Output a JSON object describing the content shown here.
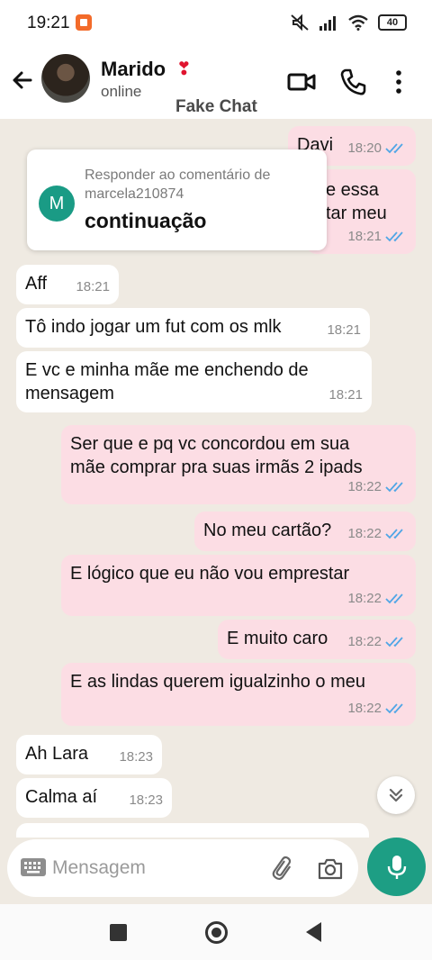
{
  "status_bar": {
    "time": "19:21",
    "battery": "40"
  },
  "header": {
    "contact_name": "Marido",
    "heart": "❣",
    "contact_status": "online",
    "watermark": "Fake Chat"
  },
  "reply_card": {
    "avatar_letter": "M",
    "title": "Responder ao comentário de marcela210874",
    "text": "continuação"
  },
  "messages": [
    {
      "dir": "out",
      "text": "Davi",
      "time": "18:20"
    },
    {
      "dir": "out",
      "text": "e essa\ntar meu",
      "time": "18:21"
    },
    {
      "dir": "in",
      "text": "Aff",
      "time": "18:21"
    },
    {
      "dir": "in",
      "text": "Tô indo jogar um fut com os mlk",
      "time": "18:21"
    },
    {
      "dir": "in",
      "text": "E vc e minha mãe me enchendo de\nmensagem",
      "time": "18:21"
    },
    {
      "dir": "out",
      "text": "Ser que e pq vc concordou em sua\nmãe comprar pra suas irmãs 2 ipads",
      "time": "18:22"
    },
    {
      "dir": "out",
      "text": "No meu cartão?",
      "time": "18:22"
    },
    {
      "dir": "out",
      "text": "E lógico que eu não vou emprestar",
      "time": "18:22"
    },
    {
      "dir": "out",
      "text": "E muito caro",
      "time": "18:22"
    },
    {
      "dir": "out",
      "text": "E as lindas querem igualzinho o meu",
      "time": "18:22"
    },
    {
      "dir": "in",
      "text": "Ah Lara",
      "time": "18:23"
    },
    {
      "dir": "in",
      "text": "Calma aí",
      "time": "18:23"
    }
  ],
  "input": {
    "placeholder": "Mensagem"
  },
  "colors": {
    "accent": "#1d9e84",
    "outgoing_bubble": "#fcdde4",
    "read_ticks": "#4fa6e6",
    "heart": "#e0142f"
  },
  "icons": [
    "back-arrow-icon",
    "video-call-icon",
    "phone-icon",
    "more-vert-icon",
    "keyboard-icon",
    "attach-icon",
    "camera-icon",
    "mic-icon",
    "double-chevron-down-icon",
    "double-check-icon"
  ]
}
